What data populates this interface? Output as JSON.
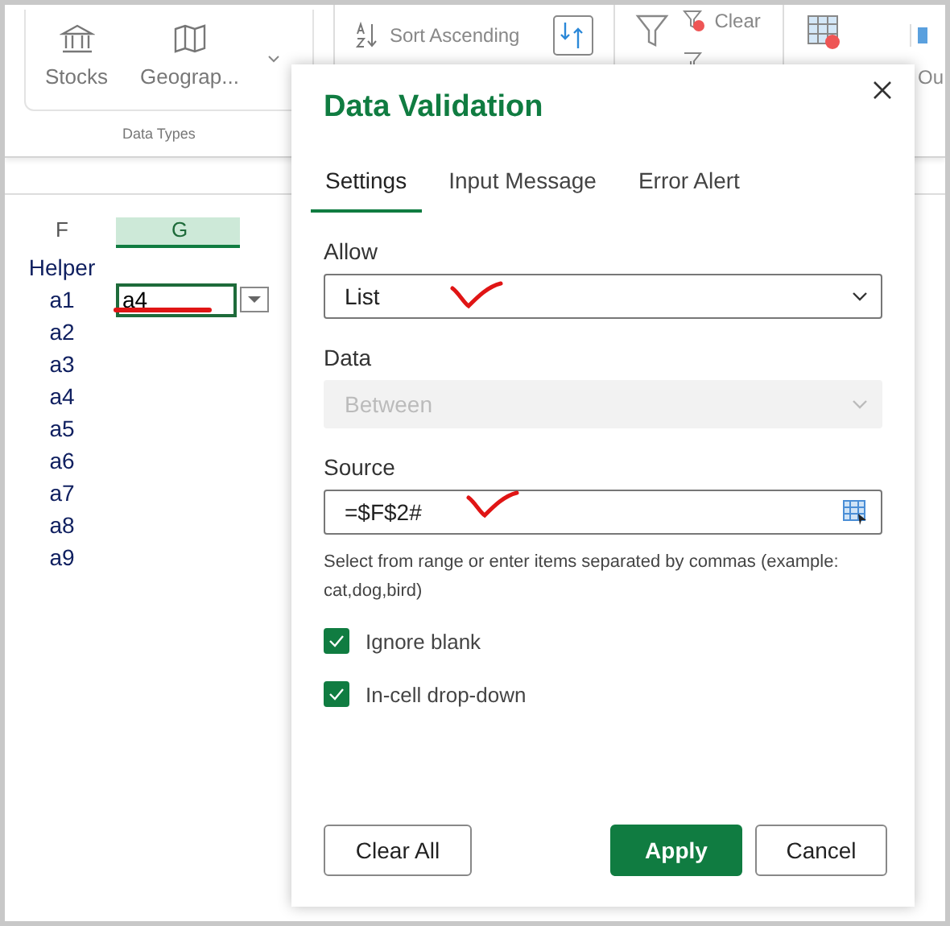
{
  "ribbon": {
    "data_types": {
      "label": "Data Types",
      "buttons": [
        {
          "label": "Stocks"
        },
        {
          "label": "Geograp..."
        }
      ]
    },
    "sort_ascending": "Sort Ascending",
    "filter_buttons": [
      "Clear"
    ],
    "cut_label": "Ou"
  },
  "sheet": {
    "columns": [
      {
        "label": "F",
        "selected": false
      },
      {
        "label": "G",
        "selected": true
      }
    ],
    "column_f": [
      "Helper",
      "a1",
      "a2",
      "a3",
      "a4",
      "a5",
      "a6",
      "a7",
      "a8",
      "a9"
    ],
    "active_cell": {
      "value": "a4"
    }
  },
  "dialog": {
    "title": "Data Validation",
    "tabs": [
      {
        "label": "Settings",
        "selected": true
      },
      {
        "label": "Input Message",
        "selected": false
      },
      {
        "label": "Error Alert",
        "selected": false
      }
    ],
    "fields": [
      {
        "label": "Allow",
        "value": "List",
        "kind": "select",
        "disabled": false
      },
      {
        "label": "Data",
        "value": "Between",
        "kind": "select",
        "disabled": true
      },
      {
        "label": "Source",
        "value": "=$F$2#",
        "kind": "range",
        "disabled": false
      }
    ],
    "hint": "Select from range or enter items separated by commas (example: cat,dog,bird)",
    "checkboxes": [
      {
        "label": "Ignore blank",
        "checked": true
      },
      {
        "label": "In-cell drop-down",
        "checked": true
      }
    ],
    "buttons": [
      {
        "label": "Clear All",
        "kind": "secondary"
      },
      {
        "label": "Apply",
        "kind": "primary"
      },
      {
        "label": "Cancel",
        "kind": "secondary"
      }
    ]
  }
}
